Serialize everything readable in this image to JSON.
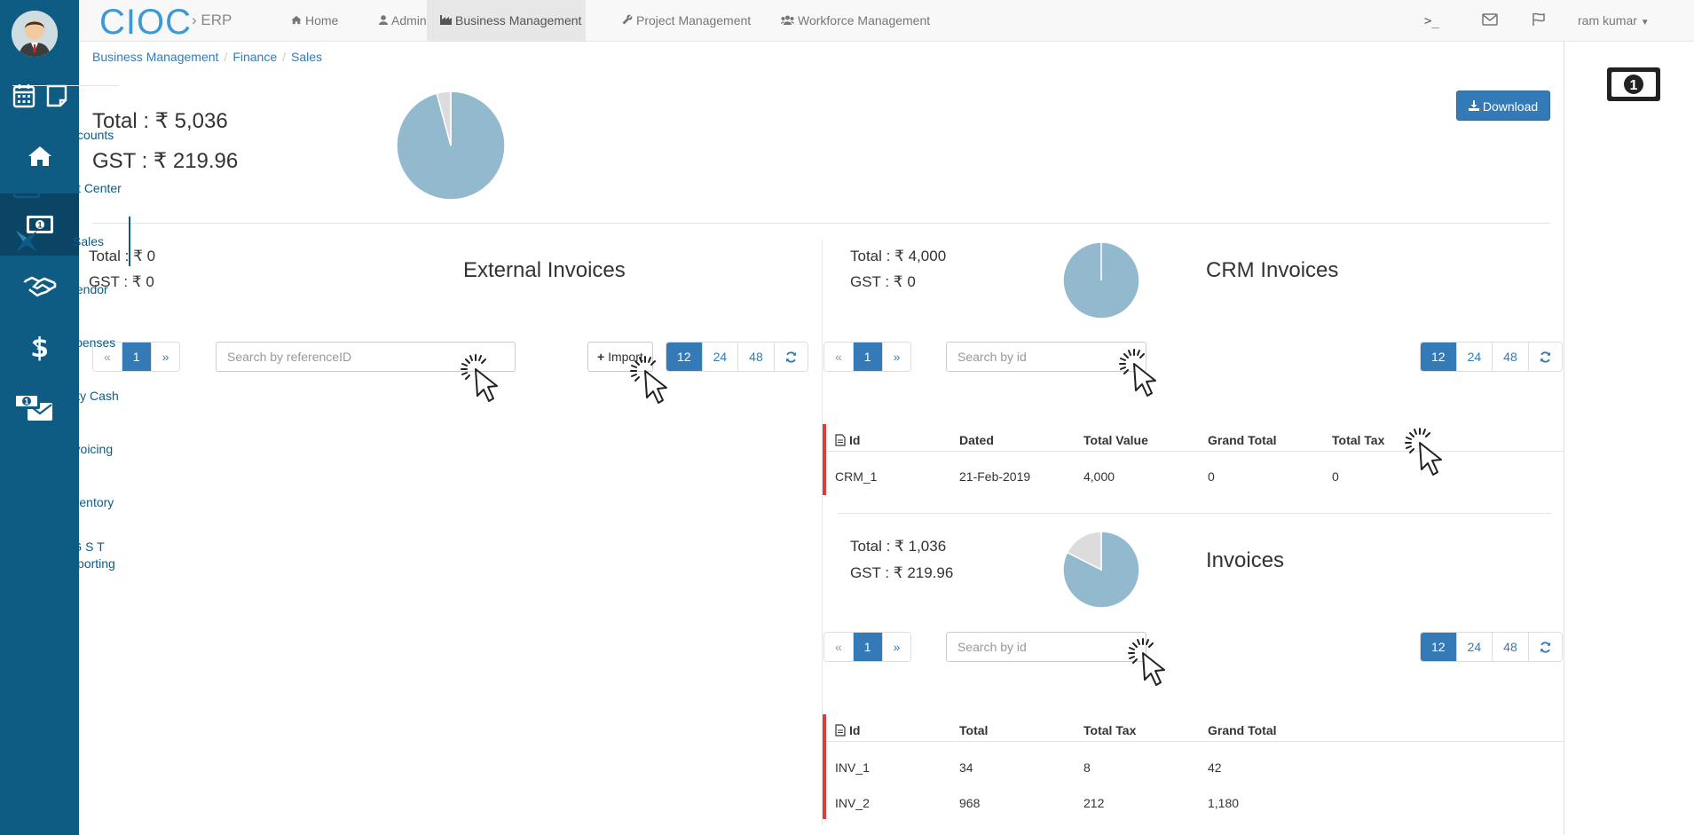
{
  "app": {
    "brand": "CIOC",
    "brand_sub": "› ERP"
  },
  "topnav": {
    "items": [
      {
        "label": "Home",
        "icon": "home-icon"
      },
      {
        "label": "Admin",
        "icon": "user-icon"
      },
      {
        "label": "Business Management",
        "icon": "industry-icon",
        "active": true
      },
      {
        "label": "Project Management",
        "icon": "wrench-icon"
      },
      {
        "label": "Workforce Management",
        "icon": "users-icon"
      }
    ],
    "right": {
      "terminal": ">_",
      "user": "ram kumar"
    }
  },
  "breadcrumb": [
    "Business Management",
    "Finance",
    "Sales"
  ],
  "summary": {
    "total": "Total : ₹ 5,036",
    "gst": "GST : ₹ 219.96",
    "download_label": "Download",
    "pie": [
      5036,
      219.96
    ]
  },
  "external": {
    "title": "External Invoices",
    "total": "Total : ₹ 0",
    "gst": "GST : ₹ 0",
    "search_placeholder": "Search by referenceID",
    "import_label": "Import",
    "pager": [
      "«",
      "1",
      "»"
    ],
    "sizes": [
      "12",
      "24",
      "48"
    ]
  },
  "crm": {
    "title": "CRM Invoices",
    "total": "Total : ₹ 4,000",
    "gst": "GST : ₹ 0",
    "search_placeholder": "Search by id",
    "pager": [
      "«",
      "1",
      "»"
    ],
    "sizes": [
      "12",
      "24",
      "48"
    ],
    "pie": [
      4000,
      0
    ],
    "columns": [
      "Id",
      "Dated",
      "Total Value",
      "Grand Total",
      "Total Tax"
    ],
    "rows": [
      [
        "CRM_1",
        "21-Feb-2019",
        "4,000",
        "0",
        "0"
      ]
    ]
  },
  "invoices": {
    "title": "Invoices",
    "total": "Total : ₹ 1,036",
    "gst": "GST : ₹ 219.96",
    "search_placeholder": "Search by id",
    "pager": [
      "«",
      "1",
      "»"
    ],
    "sizes": [
      "12",
      "24",
      "48"
    ],
    "pie": [
      1036,
      219.96
    ],
    "columns": [
      "Id",
      "Total",
      "Total Tax",
      "Grand Total"
    ],
    "rows": [
      [
        "INV_1",
        "34",
        "8",
        "42"
      ],
      [
        "INV_2",
        "968",
        "212",
        "1,180"
      ]
    ]
  },
  "rightbar": {
    "items": [
      {
        "label": "Accounts",
        "icon": "bank-icon"
      },
      {
        "label": "Cost Center",
        "icon": "credit-card-icon"
      },
      {
        "label": "Sales",
        "icon": "sales-icon",
        "active": true
      },
      {
        "label": "Vendor",
        "icon": "user-icon"
      },
      {
        "label": "Expenses",
        "icon": "sign-out-icon"
      },
      {
        "label": "Petty Cash",
        "icon": "money-icon"
      },
      {
        "label": "Invoicing",
        "icon": "document-icon"
      },
      {
        "label": "Inventory",
        "icon": "qrcode-icon"
      },
      {
        "label": "G S T",
        "label2": "Reporting",
        "icon": "percent-icon"
      }
    ]
  },
  "colors": {
    "sidebar": "#0e5b83",
    "accent": "#337ab7",
    "pie": "#93b9cf",
    "pie_rest": "#dcdcdc",
    "row_marker": "#e53935"
  }
}
